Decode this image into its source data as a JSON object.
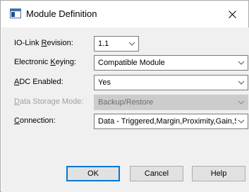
{
  "window": {
    "title": "Module Definition",
    "close_glyph": "✕"
  },
  "fields": [
    {
      "label_pre": "IO-Link ",
      "label_key": "R",
      "label_post": "evision:",
      "value": "1.1",
      "disabled": false
    },
    {
      "label_pre": "Electronic ",
      "label_key": "K",
      "label_post": "eying:",
      "value": "Compatible Module",
      "disabled": false
    },
    {
      "label_pre": "",
      "label_key": "A",
      "label_post": "DC Enabled:",
      "value": "Yes",
      "disabled": false
    },
    {
      "label_pre": "",
      "label_key": "D",
      "label_post": "ata Storage Mode:",
      "value": "Backup/Restore",
      "disabled": true
    },
    {
      "label_pre": "",
      "label_key": "C",
      "label_post": "onnection:",
      "value": "Data - Triggered,Margin,Proximity,Gain,S",
      "disabled": false
    }
  ],
  "buttons": {
    "ok": "OK",
    "cancel": "Cancel",
    "help": "Help"
  },
  "icons": {
    "title": "window-icon",
    "close": "close-icon",
    "dropdown": "chevron-down-icon"
  }
}
